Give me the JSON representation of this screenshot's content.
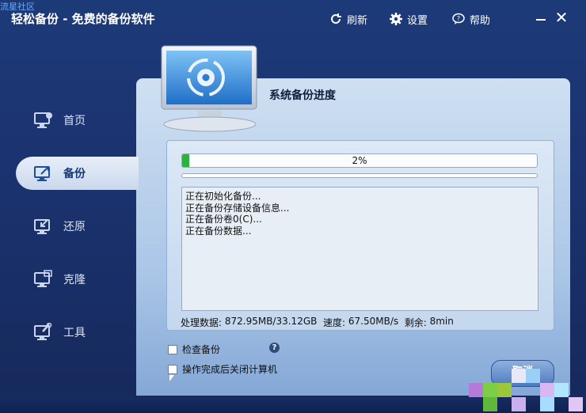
{
  "watermark": "流星社区",
  "app": {
    "title": "轻松备份 - 免费的备份软件"
  },
  "toolbar": {
    "refresh_label": "刷新",
    "settings_label": "设置",
    "help_label": "帮助"
  },
  "sidebar": {
    "items": [
      {
        "label": "首页",
        "icon": "home-monitor-icon",
        "active": false
      },
      {
        "label": "备份",
        "icon": "backup-monitor-icon",
        "active": true
      },
      {
        "label": "还原",
        "icon": "restore-monitor-icon",
        "active": false
      },
      {
        "label": "克隆",
        "icon": "clone-monitor-icon",
        "active": false
      },
      {
        "label": "工具",
        "icon": "tools-monitor-icon",
        "active": false
      }
    ]
  },
  "main": {
    "title": "系统备份进度",
    "progress": {
      "value": 0.02,
      "text": "2%"
    },
    "log": [
      "正在初始化备份...",
      "正在备份存储设备信息...",
      "正在备份卷0(C)...",
      "正在备份数据..."
    ],
    "stats": {
      "processed_label": "处理数据: ",
      "processed_value": "872.95MB/33.12GB",
      "speed_label": "速度: ",
      "speed_value": "67.50MB/s",
      "remaining_label": "剩余: ",
      "remaining_value": "8min"
    },
    "options": {
      "verify_backup": {
        "label": "检查备份",
        "checked": false
      },
      "shutdown_after": {
        "label": "操作完成后关闭计算机",
        "checked": false
      }
    },
    "help_icon_text": "?",
    "cancel_label": "取消"
  },
  "colors": {
    "accent": "#2db23b",
    "background": "#1b3370",
    "panel": "#cfe0f2"
  }
}
